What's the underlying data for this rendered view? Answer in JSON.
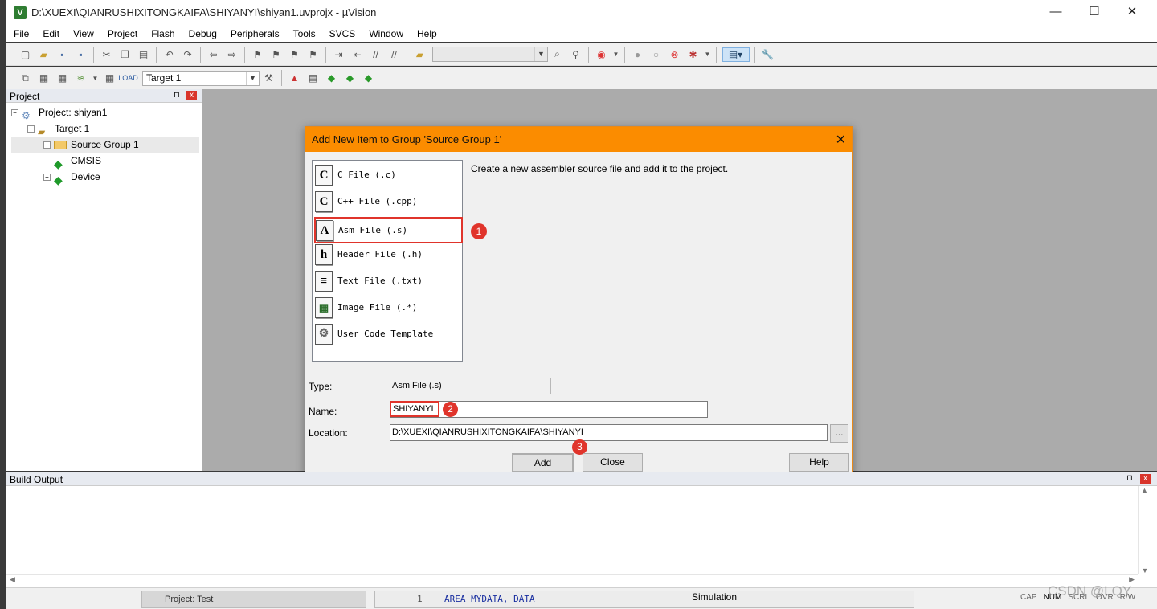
{
  "window": {
    "icon_letter": "V",
    "title": "D:\\XUEXI\\QIANRUSHIXITONGKAIFA\\SHIYANYI\\shiyan1.uvprojx - µVision",
    "minimize": "—",
    "maximize": "☐",
    "close": "✕"
  },
  "menu": [
    "File",
    "Edit",
    "View",
    "Project",
    "Flash",
    "Debug",
    "Peripherals",
    "Tools",
    "SVCS",
    "Window",
    "Help"
  ],
  "toolbar2": {
    "target_combo": "Target 1"
  },
  "project_panel": {
    "title": "Project",
    "pin": "⊓",
    "close": "x",
    "tree": {
      "project": "Project: shiyan1",
      "target": "Target 1",
      "source_group": "Source Group 1",
      "cmsis": "CMSIS",
      "device": "Device"
    }
  },
  "dialog": {
    "title": "Add New Item to Group 'Source Group 1'",
    "close": "✕",
    "file_types": [
      {
        "icon": "C",
        "label": "C File (.c)"
      },
      {
        "icon": "C",
        "label": "C++ File (.cpp)"
      },
      {
        "icon": "A",
        "label": "Asm File (.s)"
      },
      {
        "icon": "h",
        "label": "Header File (.h)"
      },
      {
        "icon": "≡",
        "label": "Text File (.txt)"
      },
      {
        "icon": "▦",
        "label": "Image File (.*)"
      },
      {
        "icon": "⚙",
        "label": "User Code Template"
      }
    ],
    "description": "Create a new assembler source file and add it to the project.",
    "type_label": "Type:",
    "type_value": "Asm File (.s)",
    "name_label": "Name:",
    "name_value": "SHIYANYI",
    "location_label": "Location:",
    "location_value": "D:\\XUEXI\\QIANRUSHIXITONGKAIFA\\SHIYANYI",
    "browse": "...",
    "add": "Add",
    "close_btn": "Close",
    "help": "Help"
  },
  "annotations": {
    "one": "1",
    "two": "2",
    "three": "3"
  },
  "build_output": {
    "title": "Build Output"
  },
  "status": {
    "simulation": "Simulation",
    "cap": "CAP",
    "num": "NUM",
    "scrl": "SCRL",
    "ovr": "OVR",
    "rw": "R/W",
    "behind_tab": "Project: Test",
    "line_no": "1",
    "code": "AREA MYDATA, DATA",
    "watermark": "CSDN @LQY"
  },
  "colors": {
    "dialog_title": "#fb8c00",
    "annotation_red": "#e0342b",
    "editor_gray": "#ababab"
  }
}
